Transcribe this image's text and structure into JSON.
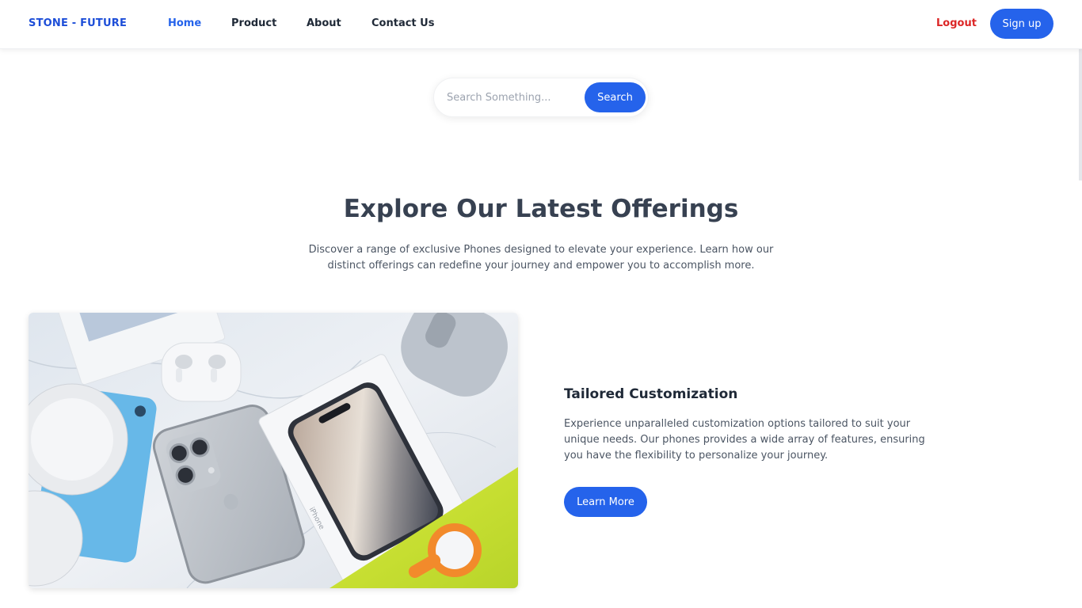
{
  "header": {
    "brand": "STONE - FUTURE",
    "nav": [
      {
        "label": "Home",
        "active": true
      },
      {
        "label": "Product",
        "active": false
      },
      {
        "label": "About",
        "active": false
      },
      {
        "label": "Contact Us",
        "active": false
      }
    ],
    "logout_label": "Logout",
    "signup_label": "Sign up"
  },
  "search": {
    "placeholder": "Search Something...",
    "value": "",
    "button_label": "Search"
  },
  "hero": {
    "title": "Explore Our Latest Offerings",
    "subtitle": "Discover a range of exclusive Phones designed to elevate your experience. Learn how our distinct offerings can redefine your journey and empower you to accomplish more."
  },
  "feature": {
    "title": "Tailored Customization",
    "text": "Experience unparalleled customization options tailored to suit your unique needs. Our phones provides a wide array of features, ensuring you have the flexibility to personalize your journey.",
    "button_label": "Learn More",
    "image_label": "iPhone"
  },
  "colors": {
    "accent": "#2563eb",
    "brand": "#1d4ed8",
    "logout": "#dc2626",
    "heading": "#374151"
  }
}
